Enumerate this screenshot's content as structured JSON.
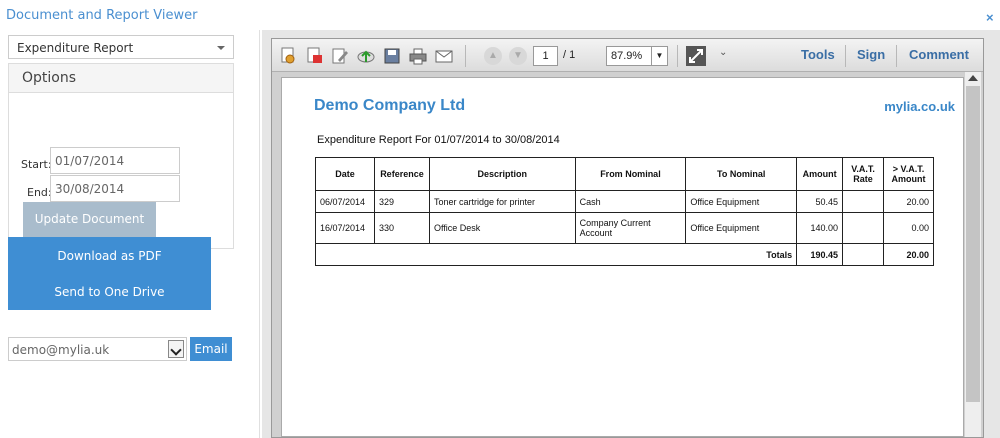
{
  "window": {
    "title": "Document and Report Viewer",
    "close_glyph": "×"
  },
  "sidebar": {
    "report_select": "Expenditure Report",
    "options_title": "Options",
    "start_label": "Start:",
    "start_value": "01/07/2014",
    "end_label": "End:",
    "end_value": "30/08/2014",
    "update_label": "Update Document",
    "download_label": "Download as PDF",
    "onedrive_label": "Send to One Drive",
    "email_value": "demo@mylia.uk",
    "email_button": "Email"
  },
  "toolbar": {
    "page_current": "1",
    "page_total": "/ 1",
    "zoom": "87.9%",
    "tools_label": "Tools",
    "sign_label": "Sign",
    "comment_label": "Comment"
  },
  "document": {
    "company": "Demo Company Ltd",
    "website": "mylia.co.uk",
    "subtitle": "Expenditure Report For 01/07/2014 to 30/08/2014",
    "headers": [
      "Date",
      "Reference",
      "Description",
      "From Nominal",
      "To Nominal",
      "Amount",
      "V.A.T. Rate",
      "> V.A.T. Amount"
    ],
    "rows": [
      [
        "06/07/2014",
        "329",
        "Toner cartridge for printer",
        "Cash",
        "Office Equipment",
        "50.45",
        "",
        "20.00"
      ],
      [
        "16/07/2014",
        "330",
        "Office Desk",
        "Company Current Account",
        "Office Equipment",
        "140.00",
        "",
        "0.00"
      ]
    ],
    "totals_label": "Totals",
    "totals_amount": "190.45",
    "totals_vat": "20.00"
  }
}
